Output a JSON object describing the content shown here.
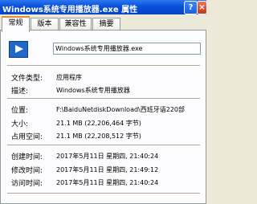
{
  "window": {
    "title": "Windows系统专用播放器.exe 属性",
    "help_label": "?",
    "close_label": "×"
  },
  "tabs": [
    {
      "label": "常规",
      "active": true
    },
    {
      "label": "版本",
      "active": false
    },
    {
      "label": "兼容性",
      "active": false
    },
    {
      "label": "摘要",
      "active": false
    }
  ],
  "file": {
    "icon": "media-player-icon",
    "name": "Windows系统专用播放器.exe"
  },
  "props": {
    "type_label": "文件类型:",
    "type_value": "应用程序",
    "desc_label": "描述:",
    "desc_value": "Windows系统专用播放器",
    "location_label": "位置:",
    "location_value": "F:\\BaiduNetdiskDownload\\西班牙语220部",
    "size_label": "大小:",
    "size_value": "21.1 MB (22,206,464 字节)",
    "disk_size_label": "占用空间:",
    "disk_size_value": "21.1 MB (22,208,512 字节)",
    "created_label": "创建时间:",
    "created_value": "2017年5月11日 星期四, 21:40:24",
    "modified_label": "修改时间:",
    "modified_value": "2017年5月11日 星期四, 21:49:12",
    "accessed_label": "访问时间:",
    "accessed_value": "2017年5月11日 星期四, 21:40:24"
  }
}
